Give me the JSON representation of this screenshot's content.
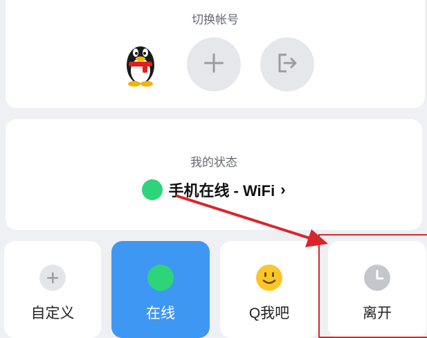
{
  "account": {
    "title": "切换帐号"
  },
  "status": {
    "title": "我的状态",
    "current": "手机在线 - WiFi",
    "chevron": "›",
    "dot_color": "#2ed47a"
  },
  "tiles": [
    {
      "label": "自定义",
      "icon": "plus-icon"
    },
    {
      "label": "在线",
      "icon": "online-dot-icon",
      "selected": true
    },
    {
      "label": "Q我吧",
      "icon": "smile-icon"
    },
    {
      "label": "离开",
      "icon": "clock-icon"
    }
  ],
  "icons": {
    "avatar": "qq-penguin-icon",
    "add_account": "plus-icon",
    "switch": "exit-icon"
  },
  "colors": {
    "accent": "#3f97f4",
    "online": "#2ed47a",
    "annotation": "#d9262a"
  }
}
